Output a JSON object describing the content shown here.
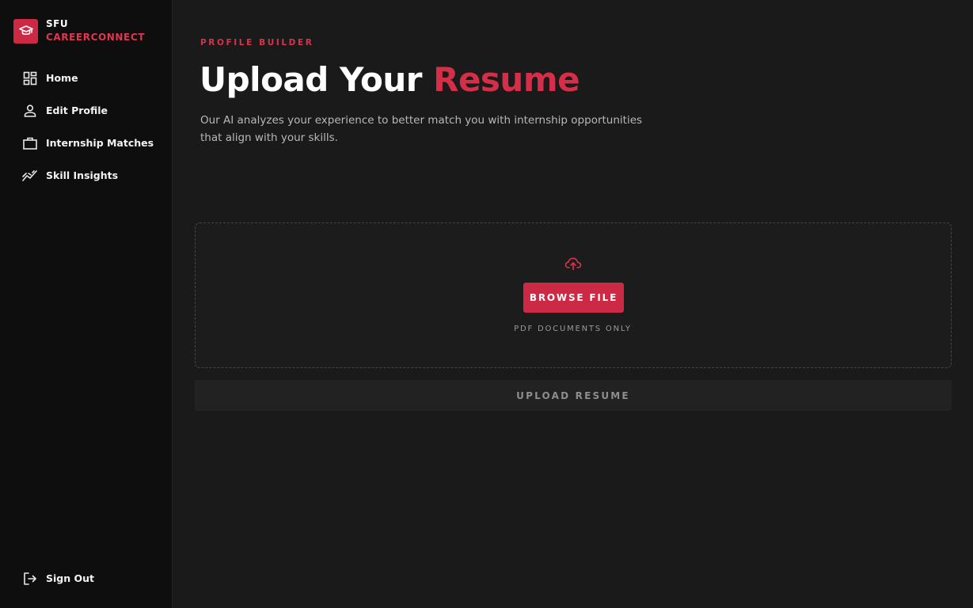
{
  "brand": {
    "line1": "SFU",
    "line2": "CAREERCONNECT",
    "logo_icon": "graduation-cap-icon"
  },
  "sidebar": {
    "items": [
      {
        "label": "Home",
        "icon": "grid-icon"
      },
      {
        "label": "Edit Profile",
        "icon": "person-icon"
      },
      {
        "label": "Internship Matches",
        "icon": "briefcase-icon"
      },
      {
        "label": "Skill Insights",
        "icon": "trend-chart-icon"
      }
    ],
    "signout": {
      "label": "Sign Out",
      "icon": "logout-icon"
    }
  },
  "main": {
    "eyebrow": "PROFILE BUILDER",
    "title_plain": "Upload Your",
    "title_accent": "Resume",
    "subtitle": "Our AI analyzes your experience to better match you with internship opportunities that align with your skills.",
    "dropzone": {
      "icon": "cloud-upload-icon",
      "browse_label": "BROWSE FILE",
      "hint": "PDF DOCUMENTS ONLY"
    },
    "upload_label": "UPLOAD RESUME"
  },
  "colors": {
    "accent": "#cc2a44",
    "sidebar_bg": "#0e0e0e",
    "main_bg": "#1a1a1a"
  }
}
